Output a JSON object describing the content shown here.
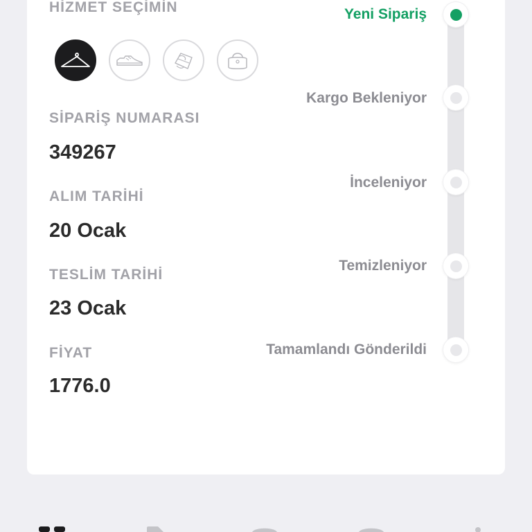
{
  "service_section": {
    "label": "HİZMET SEÇİMİN",
    "options": [
      {
        "icon": "hanger-icon",
        "selected": true
      },
      {
        "icon": "sneaker-icon",
        "selected": false
      },
      {
        "icon": "sandal-icon",
        "selected": false
      },
      {
        "icon": "handbag-icon",
        "selected": false
      }
    ]
  },
  "order": {
    "number_label": "SİPARİŞ NUMARASI",
    "number": "349267",
    "pickup_label": "ALIM TARİHİ",
    "pickup_date": "20 Ocak",
    "delivery_label": "TESLİM TARİHİ",
    "delivery_date": "23 Ocak",
    "price_label": "FİYAT",
    "price": "1776.0"
  },
  "status_steps": [
    {
      "label": "Yeni Sipariş",
      "active": true
    },
    {
      "label": "Kargo Bekleniyor",
      "active": false
    },
    {
      "label": "İnceleniyor",
      "active": false
    },
    {
      "label": "Temizleniyor",
      "active": false
    },
    {
      "label": "Tamamlandı Gönderildi",
      "active": false
    }
  ],
  "colors": {
    "accent": "#13a063",
    "label": "#a2a2a8",
    "value": "#2b2b2b"
  }
}
